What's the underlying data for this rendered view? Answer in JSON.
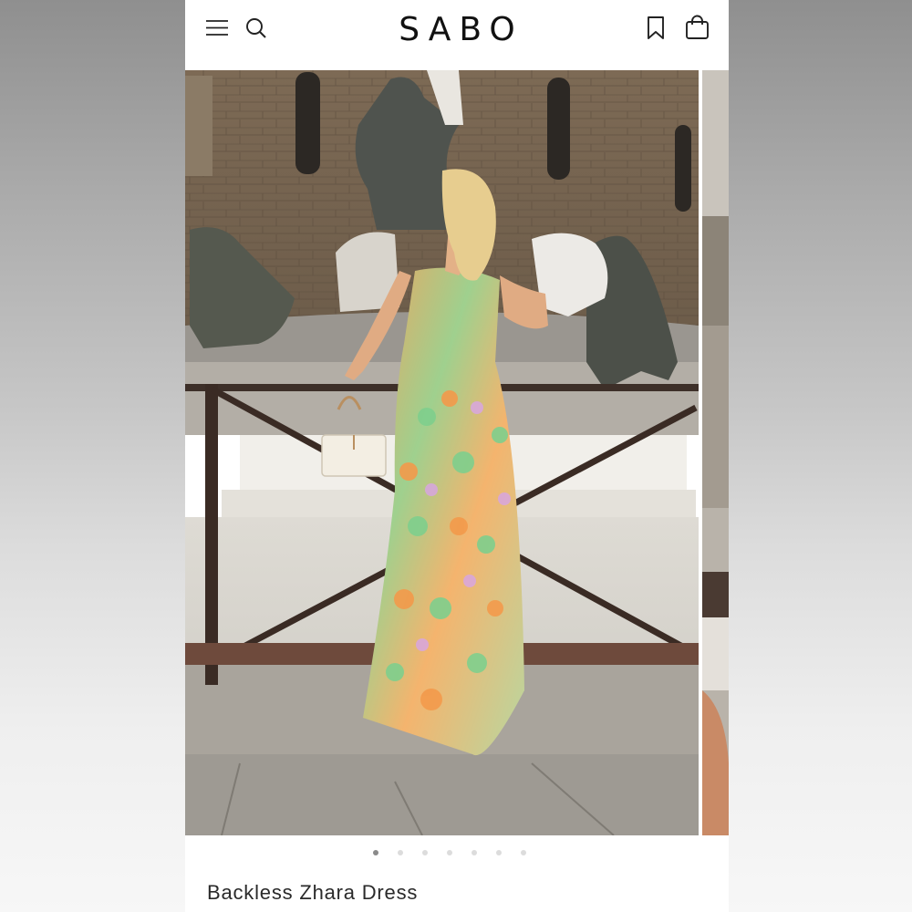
{
  "header": {
    "logo": "SABO",
    "menu_icon": "menu-icon",
    "search_icon": "search-icon",
    "bookmark_icon": "bookmark-icon",
    "bag_icon": "shopping-bag-icon"
  },
  "carousel": {
    "image_count": 7,
    "active_index": 0
  },
  "product": {
    "title": "Backless Zhara Dress"
  },
  "colors": {
    "accent": "#111111",
    "dot_active": "#8a8a8a",
    "dot_inactive": "#dcdcdc"
  }
}
